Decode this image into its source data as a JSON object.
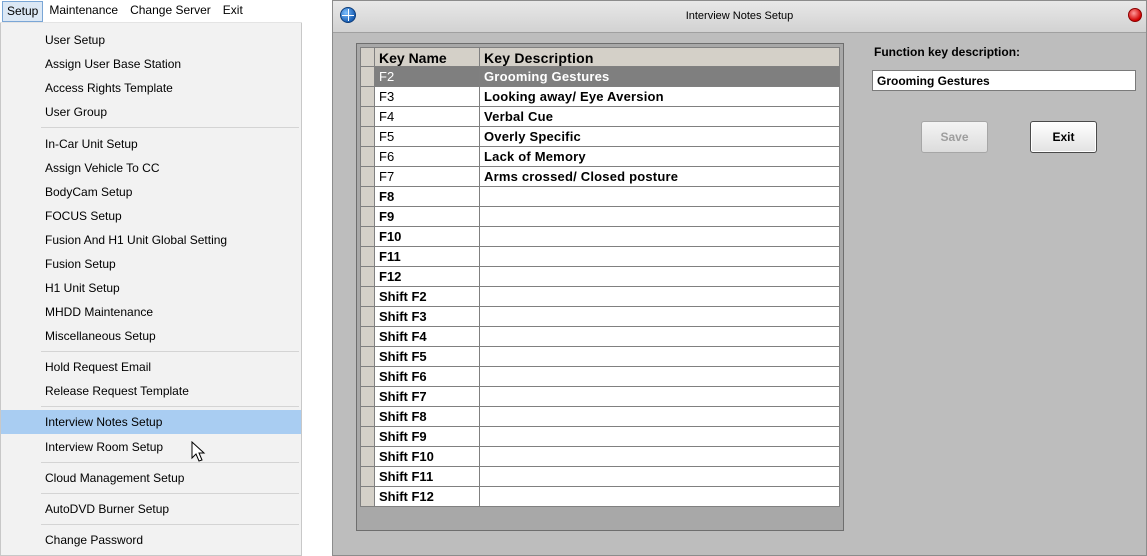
{
  "menubar": {
    "items": [
      {
        "label": "Setup"
      },
      {
        "label": "Maintenance"
      },
      {
        "label": "Change Server"
      },
      {
        "label": "Exit"
      }
    ]
  },
  "setup_menu": {
    "items": [
      {
        "label": "User Setup"
      },
      {
        "label": "Assign User Base Station"
      },
      {
        "label": "Access Rights Template"
      },
      {
        "label": "User Group"
      },
      {
        "label": "In-Car Unit Setup"
      },
      {
        "label": "Assign Vehicle To CC"
      },
      {
        "label": "BodyCam Setup"
      },
      {
        "label": "FOCUS Setup"
      },
      {
        "label": "Fusion And H1 Unit Global Setting"
      },
      {
        "label": "Fusion Setup"
      },
      {
        "label": "H1 Unit Setup"
      },
      {
        "label": "MHDD Maintenance"
      },
      {
        "label": "Miscellaneous Setup"
      },
      {
        "label": "Hold Request Email"
      },
      {
        "label": "Release Request Template"
      },
      {
        "label": "Interview Notes Setup"
      },
      {
        "label": "Interview Room Setup"
      },
      {
        "label": "Cloud Management Setup"
      },
      {
        "label": "AutoDVD Burner Setup"
      },
      {
        "label": "Change Password"
      }
    ],
    "highlighted": "Interview Notes Setup"
  },
  "dialog": {
    "title": "Interview Notes Setup",
    "grid": {
      "headers": {
        "key": "Key Name",
        "description": "Key Description"
      },
      "selected_key": "F2",
      "rows": [
        {
          "key": "F2",
          "description": "Grooming Gestures"
        },
        {
          "key": "F3",
          "description": "Looking away/ Eye Aversion"
        },
        {
          "key": "F4",
          "description": "Verbal Cue"
        },
        {
          "key": "F5",
          "description": "Overly Specific"
        },
        {
          "key": "F6",
          "description": "Lack of Memory"
        },
        {
          "key": "F7",
          "description": "Arms crossed/ Closed posture"
        },
        {
          "key": "F8",
          "description": ""
        },
        {
          "key": "F9",
          "description": ""
        },
        {
          "key": "F10",
          "description": ""
        },
        {
          "key": "F11",
          "description": ""
        },
        {
          "key": "F12",
          "description": ""
        },
        {
          "key": "Shift F2",
          "description": ""
        },
        {
          "key": "Shift F3",
          "description": ""
        },
        {
          "key": "Shift F4",
          "description": ""
        },
        {
          "key": "Shift F5",
          "description": ""
        },
        {
          "key": "Shift F6",
          "description": ""
        },
        {
          "key": "Shift F7",
          "description": ""
        },
        {
          "key": "Shift F8",
          "description": ""
        },
        {
          "key": "Shift F9",
          "description": ""
        },
        {
          "key": "Shift F10",
          "description": ""
        },
        {
          "key": "Shift F11",
          "description": ""
        },
        {
          "key": "Shift F12",
          "description": ""
        }
      ]
    },
    "function_key_label": "Function key description:",
    "function_key_value": "Grooming Gestures",
    "save_label": "Save",
    "save_enabled": false,
    "exit_label": "Exit"
  },
  "icons": {
    "app": "globe-icon",
    "close": "close-icon",
    "cursor": "mouse-pointer-icon"
  },
  "colors": {
    "menu_highlight": "#a9cdf2",
    "selected_row": "#7f7f7f",
    "dialog_bg": "#bdbdbd"
  }
}
